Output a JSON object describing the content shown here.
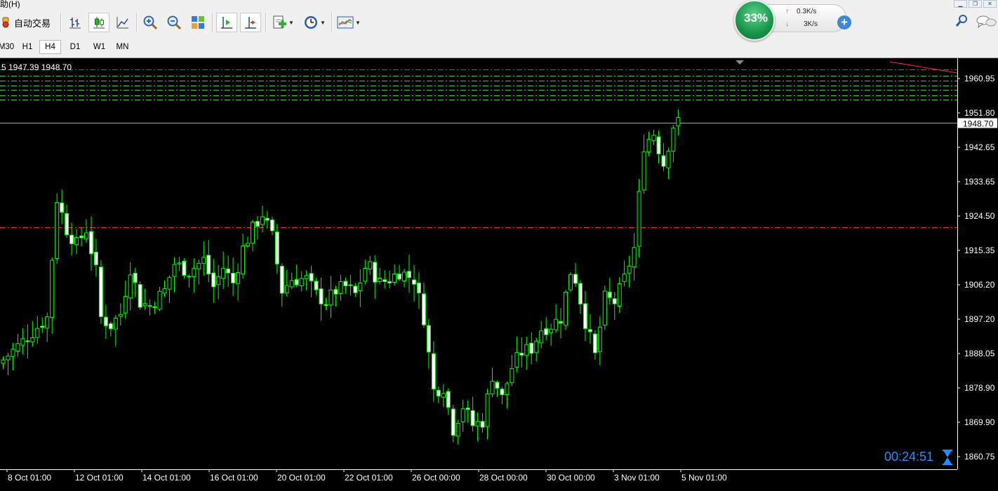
{
  "menu": {
    "partial_item": "助(H)"
  },
  "toolbar": {
    "autotrade_label": "自动交易",
    "tools": [
      "bar-chart-icon",
      "candlestick-chart-icon",
      "line-chart-icon",
      "zoom-in-icon",
      "zoom-out-icon",
      "tile-windows-icon",
      "chart-shift-icon",
      "autoscroll-icon",
      "add-indicator-icon",
      "periods-icon",
      "templates-icon"
    ]
  },
  "timeframes": [
    {
      "label": "M30",
      "active": false
    },
    {
      "label": "H1",
      "active": false
    },
    {
      "label": "H4",
      "active": true
    },
    {
      "label": "D1",
      "active": false
    },
    {
      "label": "W1",
      "active": false
    },
    {
      "label": "MN",
      "active": false
    }
  ],
  "widget": {
    "percent": "33%",
    "upload": "0.3K/s",
    "download": "3K/s"
  },
  "chart": {
    "ohlc_header": "5 1947.39 1948.70",
    "current_price": "1948.70",
    "countdown": "00:24:51",
    "colors": {
      "background": "#000000",
      "candle": "#00ff00",
      "candle_fill": "#ffffff",
      "axis_text": "#ffffff",
      "red_level": "#ff2a2a",
      "green_level": "#3ccc3c",
      "price_line": "#9aa3b0"
    }
  },
  "chart_data": {
    "type": "candlestick",
    "ylim": [
      1858.5,
      1965.5
    ],
    "ytick_labels": [
      "1960.95",
      "1951.80",
      "1942.65",
      "1933.65",
      "1924.50",
      "1915.35",
      "1906.20",
      "1897.20",
      "1888.05",
      "1878.90",
      "1869.90",
      "1860.75"
    ],
    "xtick_labels": [
      "8 Oct 01:00",
      "12 Oct 01:00",
      "14 Oct 01:00",
      "16 Oct 01:00",
      "20 Oct 01:00",
      "22 Oct 01:00",
      "26 Oct 00:00",
      "28 Oct 00:00",
      "30 Oct 00:00",
      "3 Nov 01:00",
      "5 Nov 01:00"
    ],
    "horizontal_levels": [
      {
        "price": 1962.5,
        "color": "red"
      },
      {
        "price": 1960.9,
        "color": "green"
      },
      {
        "price": 1959.7,
        "color": "green"
      },
      {
        "price": 1958.4,
        "color": "green"
      },
      {
        "price": 1957.2,
        "color": "green"
      },
      {
        "price": 1955.9,
        "color": "green"
      },
      {
        "price": 1954.7,
        "color": "green"
      },
      {
        "price": 1921.5,
        "color": "red"
      }
    ],
    "current_price": 1948.7,
    "close_path": [
      [
        0,
        1887
      ],
      [
        5,
        1893
      ],
      [
        9,
        1898
      ],
      [
        11,
        1929
      ],
      [
        13,
        1921
      ],
      [
        15,
        1917
      ],
      [
        17,
        1921
      ],
      [
        19,
        1910
      ],
      [
        20,
        1898
      ],
      [
        22,
        1896
      ],
      [
        24,
        1899
      ],
      [
        26,
        1911
      ],
      [
        28,
        1902
      ],
      [
        30,
        1901
      ],
      [
        33,
        1905
      ],
      [
        35,
        1912
      ],
      [
        38,
        1910
      ],
      [
        41,
        1913
      ],
      [
        43,
        1906
      ],
      [
        45,
        1911
      ],
      [
        47,
        1907
      ],
      [
        49,
        1916
      ],
      [
        51,
        1921
      ],
      [
        53,
        1925
      ],
      [
        55,
        1919
      ],
      [
        57,
        1905
      ],
      [
        59,
        1908
      ],
      [
        62,
        1908
      ],
      [
        64,
        1904
      ],
      [
        66,
        1902
      ],
      [
        68,
        1905
      ],
      [
        70,
        1906
      ],
      [
        72,
        1904
      ],
      [
        74,
        1911
      ],
      [
        75,
        1911
      ],
      [
        77,
        1907
      ],
      [
        79,
        1908
      ],
      [
        81,
        1910
      ],
      [
        84,
        1908
      ],
      [
        86,
        1898
      ],
      [
        88,
        1879
      ],
      [
        90,
        1880
      ],
      [
        92,
        1869
      ],
      [
        94,
        1875
      ],
      [
        96,
        1870
      ],
      [
        98,
        1871
      ],
      [
        100,
        1883
      ],
      [
        102,
        1877
      ],
      [
        104,
        1885
      ],
      [
        106,
        1889
      ],
      [
        108,
        1890
      ],
      [
        110,
        1895
      ],
      [
        112,
        1896
      ],
      [
        114,
        1898
      ],
      [
        116,
        1910
      ],
      [
        117,
        1908
      ],
      [
        119,
        1897
      ],
      [
        121,
        1888
      ],
      [
        123,
        1903
      ],
      [
        125,
        1902
      ],
      [
        127,
        1908
      ],
      [
        129,
        1916
      ],
      [
        131,
        1943
      ],
      [
        133,
        1946
      ],
      [
        135,
        1938
      ],
      [
        137,
        1948
      ],
      [
        138,
        1948.7
      ]
    ],
    "candle_count": 139
  }
}
